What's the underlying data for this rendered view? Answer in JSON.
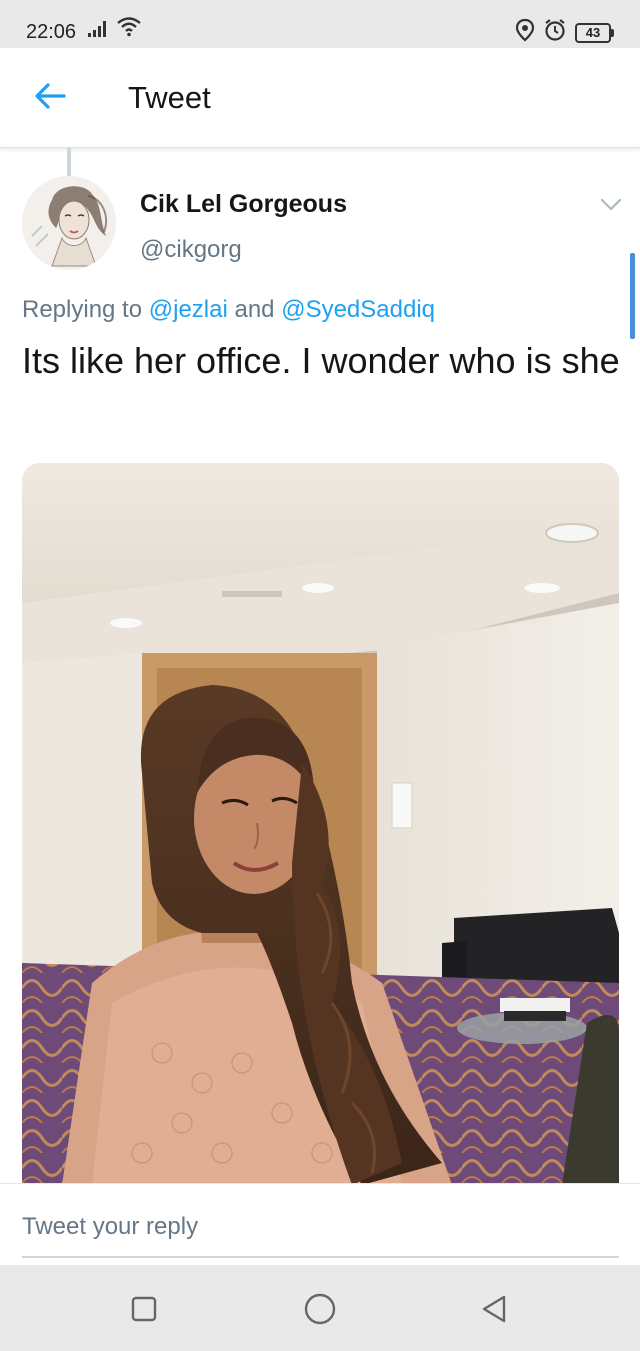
{
  "status_bar": {
    "time": "22:06",
    "battery": "43",
    "icons": [
      "signal-icon",
      "wifi-icon",
      "location-icon",
      "alarm-icon",
      "battery-icon"
    ]
  },
  "app_bar": {
    "title": "Tweet",
    "back_icon": "arrow-left-icon"
  },
  "tweet": {
    "display_name": "Cik Lel Gorgeous",
    "handle": "@cikgorg",
    "replying_prefix": "Replying to ",
    "mention_1": "@jezlai",
    "mention_join": " and ",
    "mention_2": "@SyedSaddiq",
    "text": "Its like her office. I wonder who is she",
    "more_icon": "chevron-down-icon"
  },
  "reply": {
    "placeholder": "Tweet your reply"
  },
  "nav_bar": {
    "icons": [
      "recents-square-icon",
      "home-circle-icon",
      "back-triangle-icon"
    ]
  },
  "colors": {
    "accent": "#1da1f2",
    "secondary_text": "#657786",
    "primary_text": "#14171a"
  }
}
